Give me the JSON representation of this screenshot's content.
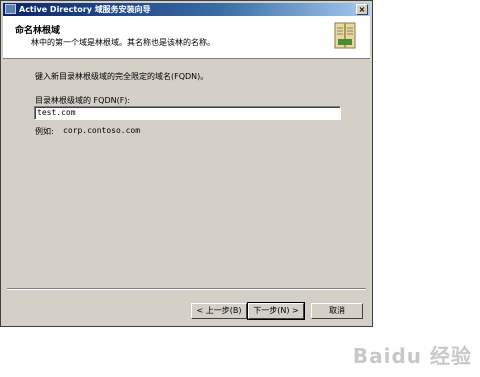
{
  "window": {
    "title": "Active Directory 域服务安装向导",
    "close_glyph": "×"
  },
  "header": {
    "title": "命名林根域",
    "subtitle": "林中的第一个域是林根域。其名称也是该林的名称。"
  },
  "main": {
    "instruction": "键入新目录林根级域的完全限定的域名(FQDN)。",
    "fqdn_label": "目录林根级域的 FQDN(F):",
    "fqdn_value": "test.com",
    "example_label": "例如:",
    "example_value": "corp.contoso.com"
  },
  "buttons": {
    "back": "< 上一步(B)",
    "next": "下一步(N) >",
    "cancel": "取消"
  },
  "watermark": "Baidu 经验",
  "icons": {
    "app": "ad-app-icon",
    "header": "book-icon"
  }
}
